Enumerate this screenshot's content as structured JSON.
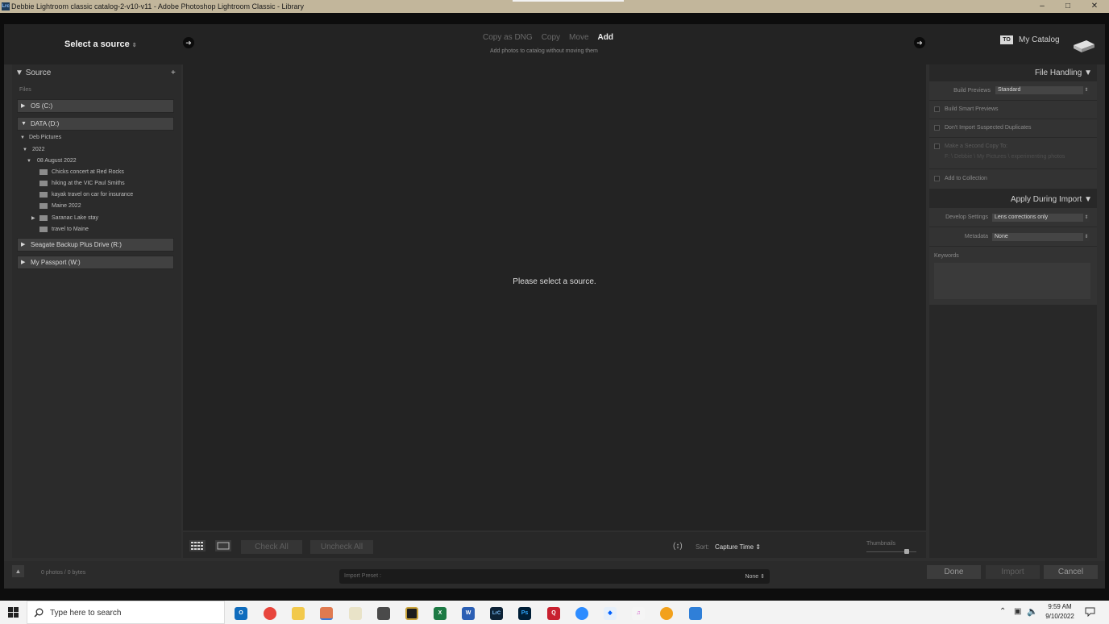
{
  "window": {
    "title": "Debbie Lightroom classic catalog-2-v10-v11 - Adobe Photoshop Lightroom Classic - Library",
    "app_icon": "Lrc",
    "controls": {
      "minimize": "–",
      "maximize": "□",
      "close": "✕"
    }
  },
  "import_header": {
    "select_source": "Select a source",
    "modes": [
      "Copy as DNG",
      "Copy",
      "Move",
      "Add"
    ],
    "active_mode": "Add",
    "mode_description": "Add photos to catalog without moving them",
    "to_badge": "TO",
    "destination": "My Catalog"
  },
  "source_panel": {
    "title": "Source",
    "add_symbol": "+",
    "files_label": "Files",
    "drives": [
      {
        "label": "OS (C:)",
        "expanded": false
      },
      {
        "label": "DATA (D:)",
        "expanded": true
      },
      {
        "label": "Seagate Backup Plus Drive (R:)",
        "expanded": false
      },
      {
        "label": "My Passport (W:)",
        "expanded": false
      }
    ],
    "tree": {
      "root": "Deb Pictures",
      "year": "2022",
      "month": "08 August 2022",
      "folders": [
        "Chicks concert at Red Rocks",
        "hiking at the VIC Paul Smiths",
        "kayak travel on car for insurance",
        "Maine 2022",
        "Saranac Lake stay",
        "travel to Maine"
      ]
    }
  },
  "center": {
    "message": "Please select a source."
  },
  "toolbar": {
    "check_all": "Check All",
    "uncheck_all": "Uncheck All",
    "sort_label": "Sort:",
    "sort_value": "Capture Time",
    "thumbnails_label": "Thumbnails",
    "thumbnail_size_fraction": 0.8
  },
  "file_handling": {
    "title": "File Handling",
    "build_previews_label": "Build Previews",
    "build_previews_value": "Standard",
    "build_smart_previews": "Build Smart Previews",
    "dont_import_duplicates": "Don't Import Suspected Duplicates",
    "second_copy": "Make a Second Copy To:",
    "second_copy_path": "F: \\ Debbie \\ My Pictures \\ experimenting photos",
    "add_to_collection": "Add to Collection"
  },
  "apply_during_import": {
    "title": "Apply During Import",
    "develop_settings_label": "Develop Settings",
    "develop_settings_value": "Lens corrections only",
    "metadata_label": "Metadata",
    "metadata_value": "None",
    "keywords_label": "Keywords"
  },
  "bottom": {
    "status": "0 photos / 0 bytes",
    "import_preset_label": "Import Preset :",
    "import_preset_value": "None",
    "done": "Done",
    "import": "Import",
    "cancel": "Cancel"
  },
  "taskbar": {
    "search_placeholder": "Type here to search",
    "time": "9:59 AM",
    "date": "9/10/2022",
    "apps": [
      "outlook",
      "chrome",
      "file-explorer",
      "photos",
      "notepad",
      "calculator",
      "app",
      "excel",
      "word",
      "lightroom-classic",
      "photoshop",
      "quicken",
      "zoom",
      "dropbox",
      "itunes",
      "edge",
      "calendar"
    ]
  }
}
